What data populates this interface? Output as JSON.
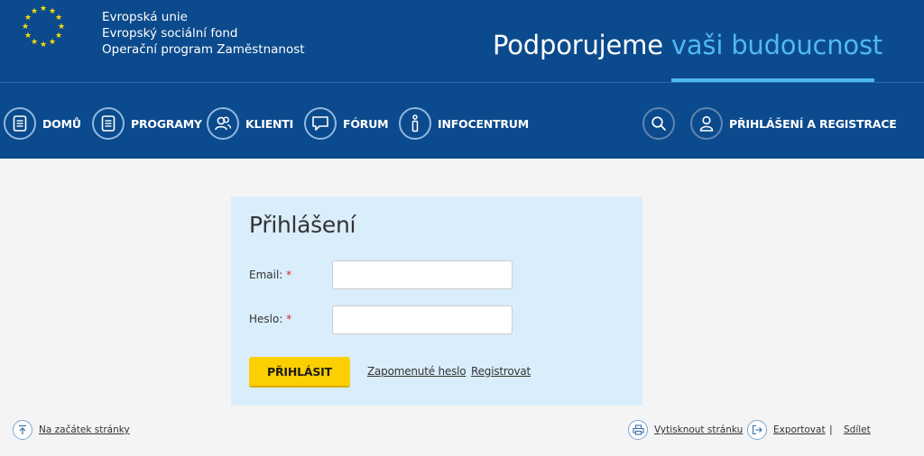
{
  "header": {
    "eu_lines": [
      "Evropská unie",
      "Evropský sociální fond",
      "Operační program Zaměstnanost"
    ],
    "slogan_main": "Podporujeme ",
    "slogan_highlight": "vaši budoucnost",
    "colors": {
      "background": "#0b4a8c",
      "accent": "#4fb8f2"
    }
  },
  "nav": {
    "items": [
      {
        "label": "DOMŮ",
        "icon": "document-icon"
      },
      {
        "label": "PROGRAMY",
        "icon": "document-icon"
      },
      {
        "label": "KLIENTI",
        "icon": "users-icon"
      },
      {
        "label": "FÓRUM",
        "icon": "speech-bubble-icon"
      },
      {
        "label": "INFOCENTRUM",
        "icon": "info-icon"
      }
    ],
    "search_icon": "search-icon",
    "login": {
      "label": "PŘIHLÁŠENÍ A REGISTRACE",
      "icon": "user-icon"
    }
  },
  "login_form": {
    "title": "Přihlášení",
    "email_label": "Email:",
    "email_value": "",
    "password_label": "Heslo:",
    "password_value": "",
    "required_mark": "*",
    "submit_label": "PŘIHLÁSIT",
    "forgot_label": "Zapomenuté heslo",
    "register_label": "Registrovat",
    "colors": {
      "background": "#d9edfb",
      "button": "#fccf00",
      "required": "#d9262c"
    }
  },
  "footer": {
    "top_label": "Na začátek stránky",
    "print_label": "Vytisknout stránku",
    "export_label": "Exportovat",
    "separator": "|",
    "share_label": "Sdílet"
  }
}
